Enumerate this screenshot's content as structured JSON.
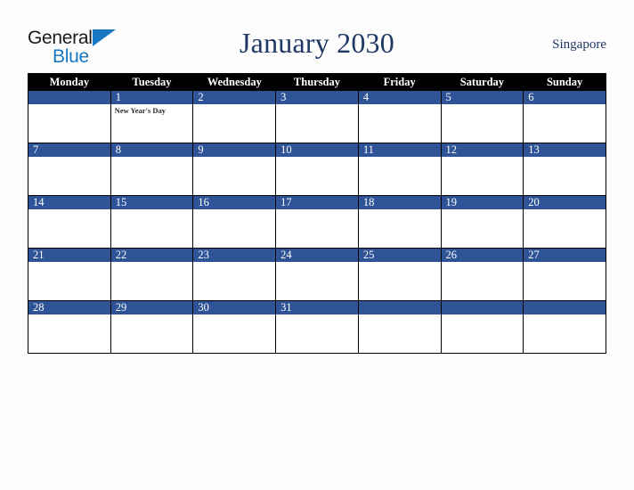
{
  "logo": {
    "text_primary": "General",
    "text_secondary": "Blue",
    "triangle_color": "#1878c4"
  },
  "header": {
    "title": "January 2030",
    "country": "Singapore",
    "title_color": "#1f3864"
  },
  "colors": {
    "header_row_bg": "#000000",
    "day_bar_bg": "#2e5396",
    "cell_bg": "#ffffff",
    "page_bg": "#fdfdfd",
    "grid_line": "#000000"
  },
  "calendar": {
    "weekday_headers": [
      "Monday",
      "Tuesday",
      "Wednesday",
      "Thursday",
      "Friday",
      "Saturday",
      "Sunday"
    ],
    "weeks": [
      [
        {
          "day": "",
          "events": []
        },
        {
          "day": "1",
          "events": [
            "New Year's Day"
          ]
        },
        {
          "day": "2",
          "events": []
        },
        {
          "day": "3",
          "events": []
        },
        {
          "day": "4",
          "events": []
        },
        {
          "day": "5",
          "events": []
        },
        {
          "day": "6",
          "events": []
        }
      ],
      [
        {
          "day": "7",
          "events": []
        },
        {
          "day": "8",
          "events": []
        },
        {
          "day": "9",
          "events": []
        },
        {
          "day": "10",
          "events": []
        },
        {
          "day": "11",
          "events": []
        },
        {
          "day": "12",
          "events": []
        },
        {
          "day": "13",
          "events": []
        }
      ],
      [
        {
          "day": "14",
          "events": []
        },
        {
          "day": "15",
          "events": []
        },
        {
          "day": "16",
          "events": []
        },
        {
          "day": "17",
          "events": []
        },
        {
          "day": "18",
          "events": []
        },
        {
          "day": "19",
          "events": []
        },
        {
          "day": "20",
          "events": []
        }
      ],
      [
        {
          "day": "21",
          "events": []
        },
        {
          "day": "22",
          "events": []
        },
        {
          "day": "23",
          "events": []
        },
        {
          "day": "24",
          "events": []
        },
        {
          "day": "25",
          "events": []
        },
        {
          "day": "26",
          "events": []
        },
        {
          "day": "27",
          "events": []
        }
      ],
      [
        {
          "day": "28",
          "events": []
        },
        {
          "day": "29",
          "events": []
        },
        {
          "day": "30",
          "events": []
        },
        {
          "day": "31",
          "events": []
        },
        {
          "day": "",
          "events": []
        },
        {
          "day": "",
          "events": []
        },
        {
          "day": "",
          "events": []
        }
      ]
    ]
  }
}
